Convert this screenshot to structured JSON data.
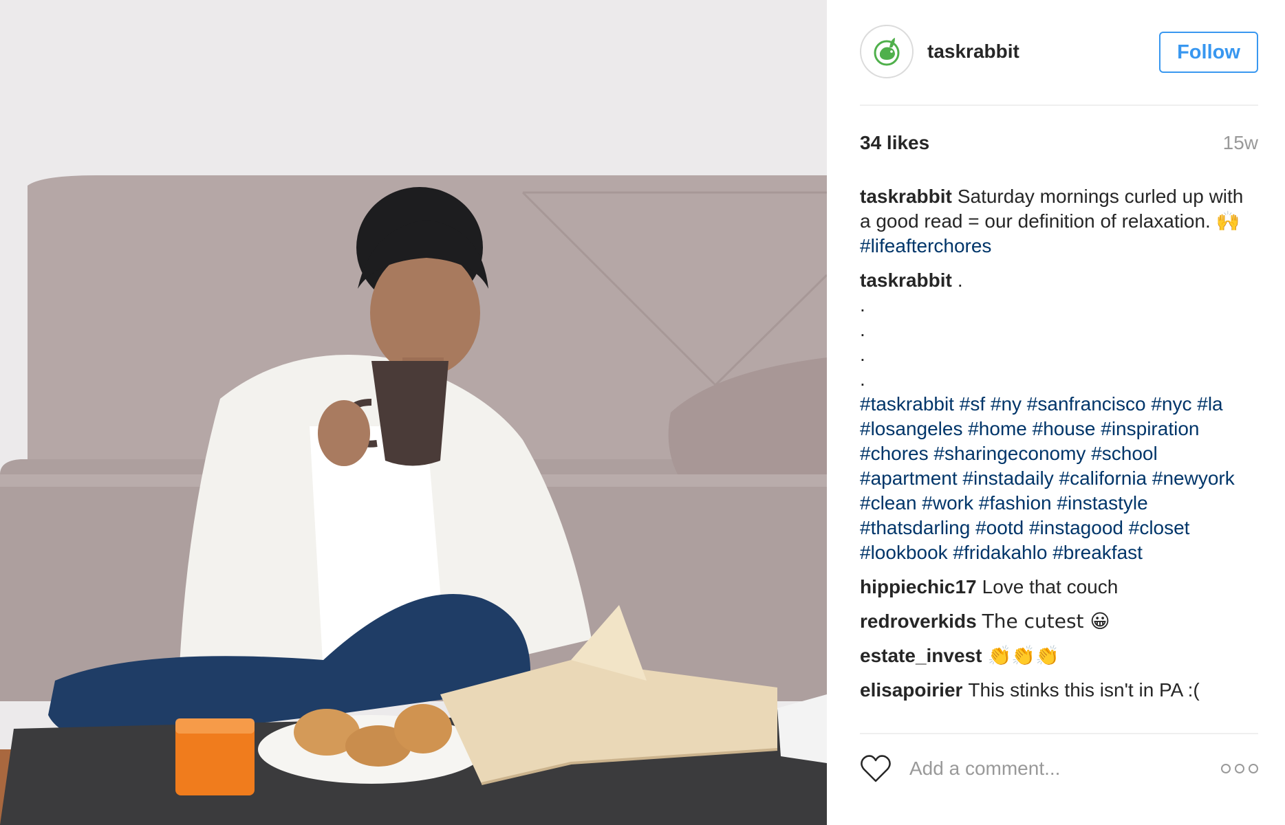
{
  "header": {
    "username": "taskrabbit",
    "follow_label": "Follow",
    "avatar_icon": "rabbit-logo-icon",
    "brand_color": "#4fb04b"
  },
  "stats": {
    "likes": "34 likes",
    "timestamp": "15w"
  },
  "caption": {
    "author": "taskrabbit",
    "text": "Saturday mornings curled up with a good read = our definition of relaxation. 🙌 ",
    "hashtag": "#lifeafterchores"
  },
  "second_comment": {
    "author": "taskrabbit",
    "first_line": ".",
    "dots": [
      ".",
      ".",
      ".",
      "."
    ],
    "hashtags": "#taskrabbit #sf #ny #sanfrancisco #nyc #la #losangeles #home #house #inspiration #chores #sharingeconomy #school #apartment #instadaily #california #newyork #clean #work #fashion #instastyle #thatsdarling #ootd #instagood #closet #lookbook #fridakahlo #breakfast"
  },
  "comments": [
    {
      "author": "hippiechic17",
      "text": "Love that couch"
    },
    {
      "author": "redroverkids",
      "text": "The cutest 😀"
    },
    {
      "author": "estate_invest",
      "text": "👏👏👏"
    },
    {
      "author": "elisapoirier",
      "text": "This stinks this isn't in PA :("
    }
  ],
  "footer": {
    "comment_placeholder": "Add a comment...",
    "like_icon": "heart-icon",
    "more_icon": "more-options-icon"
  },
  "colors": {
    "link": "#003569",
    "follow": "#3897f0",
    "muted": "#999999"
  }
}
